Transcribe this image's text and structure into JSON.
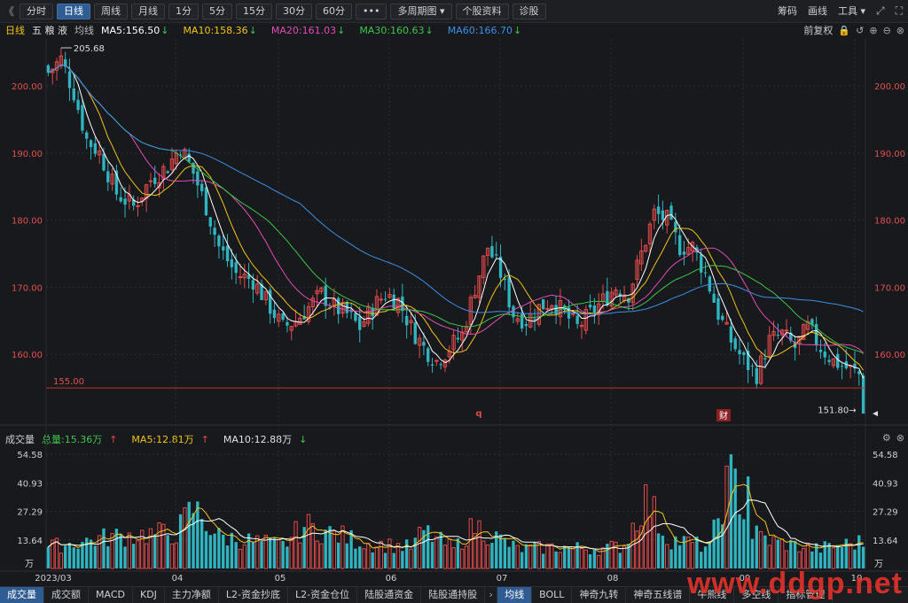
{
  "toolbar": {
    "collapse": "《",
    "buttons": [
      "分时",
      "日线",
      "周线",
      "月线",
      "1分",
      "5分",
      "15分",
      "30分",
      "60分",
      "•••",
      "多周期图 ▾",
      "个股资料",
      "诊股"
    ],
    "active_index": 1,
    "right": {
      "code": "筹码",
      "draw": "画线",
      "tools": "工具 ▾",
      "expand": "⤢",
      "fullscreen": "⛶"
    }
  },
  "main_legend": {
    "period": "日线",
    "stock_name": "五 粮 液",
    "ma_label": "均线",
    "ma": [
      {
        "label": "MA5:156.50",
        "color": "#ffffff"
      },
      {
        "label": "MA10:158.36",
        "color": "#f0c419"
      },
      {
        "label": "MA20:161.03",
        "color": "#e24bb5"
      },
      {
        "label": "MA30:160.63",
        "color": "#3cc64a"
      },
      {
        "label": "MA60:166.70",
        "color": "#3b8fe6"
      }
    ],
    "adjust": "前复权"
  },
  "vol_legend": {
    "label": "成交量",
    "total": "总量:15.36万",
    "ma5": "MA5:12.81万",
    "ma10": "MA10:12.88万"
  },
  "chart_data": {
    "type": "candlestick",
    "price_axis": {
      "ticks": [
        "200.00",
        "190.00",
        "180.00",
        "170.00",
        "160.00"
      ],
      "tick_values": [
        200,
        190,
        180,
        170,
        160
      ],
      "ylim": [
        150,
        207
      ]
    },
    "high_marker": "205.68",
    "low_marker": "151.80",
    "support_line": {
      "value": 155.0,
      "label": "155.00"
    },
    "vol_axis": {
      "ticks": [
        "54.58",
        "40.93",
        "27.29",
        "13.64"
      ],
      "unit": "万"
    },
    "x_labels": [
      "2023/03",
      "04",
      "05",
      "06",
      "07",
      "08",
      "09",
      "10"
    ],
    "events": [
      {
        "label": "q"
      },
      {
        "label": "财"
      }
    ],
    "colors": {
      "up": "#e04a4a",
      "down": "#2fb4c0",
      "grid": "#2a2b30",
      "support": "#c03030"
    },
    "anchors": [
      [
        0,
        202
      ],
      [
        3,
        204
      ],
      [
        6,
        199
      ],
      [
        9,
        192
      ],
      [
        12,
        190
      ],
      [
        16,
        184
      ],
      [
        20,
        182
      ],
      [
        24,
        186
      ],
      [
        28,
        188
      ],
      [
        31,
        191
      ],
      [
        34,
        187
      ],
      [
        37,
        182
      ],
      [
        40,
        176
      ],
      [
        44,
        172
      ],
      [
        48,
        171
      ],
      [
        52,
        167
      ],
      [
        55,
        164
      ],
      [
        58,
        165
      ],
      [
        61,
        167
      ],
      [
        64,
        169
      ],
      [
        67,
        167
      ],
      [
        70,
        166
      ],
      [
        73,
        164
      ],
      [
        76,
        167
      ],
      [
        79,
        169
      ],
      [
        82,
        168
      ],
      [
        85,
        164
      ],
      [
        88,
        161
      ],
      [
        91,
        159
      ],
      [
        94,
        161
      ],
      [
        97,
        163
      ],
      [
        100,
        170
      ],
      [
        103,
        176
      ],
      [
        106,
        172
      ],
      [
        109,
        166
      ],
      [
        112,
        165
      ],
      [
        115,
        167
      ],
      [
        118,
        168
      ],
      [
        121,
        166
      ],
      [
        124,
        164
      ],
      [
        127,
        166
      ],
      [
        130,
        168
      ],
      [
        133,
        170
      ],
      [
        136,
        169
      ],
      [
        139,
        175
      ],
      [
        142,
        181
      ],
      [
        145,
        180
      ],
      [
        148,
        176
      ],
      [
        151,
        176
      ],
      [
        154,
        172
      ],
      [
        157,
        166
      ],
      [
        160,
        162
      ],
      [
        163,
        159
      ],
      [
        166,
        157
      ],
      [
        169,
        162
      ],
      [
        172,
        163
      ],
      [
        175,
        161
      ],
      [
        178,
        164
      ],
      [
        181,
        161
      ],
      [
        184,
        159
      ],
      [
        187,
        158
      ],
      [
        190,
        157
      ],
      [
        191,
        152
      ]
    ],
    "volume": [
      {
        "x": 0,
        "v": 12
      },
      {
        "x": 15,
        "v": 18
      },
      {
        "x": 30,
        "v": 20
      },
      {
        "x": 34,
        "v": 34
      },
      {
        "x": 40,
        "v": 18
      },
      {
        "x": 55,
        "v": 13
      },
      {
        "x": 60,
        "v": 24
      },
      {
        "x": 75,
        "v": 14
      },
      {
        "x": 85,
        "v": 12
      },
      {
        "x": 88,
        "v": 21
      },
      {
        "x": 95,
        "v": 11
      },
      {
        "x": 100,
        "v": 24
      },
      {
        "x": 110,
        "v": 11
      },
      {
        "x": 120,
        "v": 12
      },
      {
        "x": 130,
        "v": 11
      },
      {
        "x": 135,
        "v": 13
      },
      {
        "x": 140,
        "v": 40
      },
      {
        "x": 145,
        "v": 17
      },
      {
        "x": 155,
        "v": 12
      },
      {
        "x": 160,
        "v": 54.58
      },
      {
        "x": 165,
        "v": 20
      },
      {
        "x": 170,
        "v": 15
      },
      {
        "x": 180,
        "v": 11
      },
      {
        "x": 191,
        "v": 15
      }
    ]
  },
  "bottom_tabs": [
    "成交量",
    "成交额",
    "MACD",
    "KDJ",
    "主力净额",
    "L2-资金抄底",
    "L2-资金仓位",
    "陆股通资金",
    "陆股通持股",
    "›",
    "均线",
    "BOLL",
    "神奇九转",
    "神奇五线谱",
    "牛熊线",
    "多空线",
    "指标管理"
  ],
  "bottom_active": [
    0,
    10
  ],
  "watermark": "www.ddgp.net"
}
